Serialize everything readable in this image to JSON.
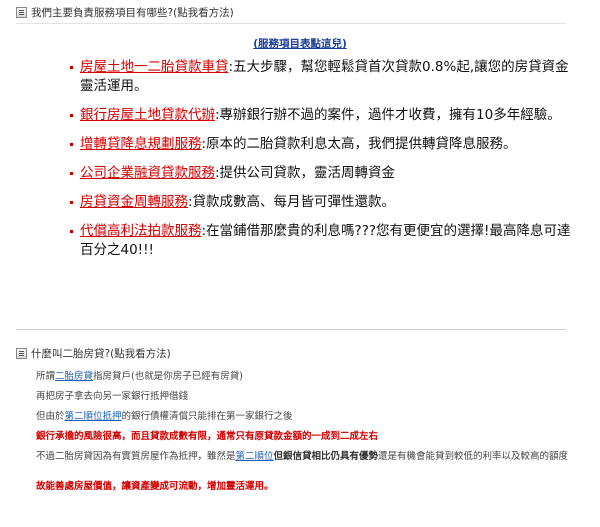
{
  "faq1": {
    "title": "我們主要負責服務項目有哪些?(點我看方法)",
    "service_link": "(服務項目表點這兒)"
  },
  "services": [
    {
      "link": "房屋土地一二胎貸款車貸",
      "desc": ":五大步驟，幫您輕鬆貸首次貸款0.8%起,讓您的房貸資金靈活運用。"
    },
    {
      "link": "銀行房屋土地貸款代辦",
      "desc": ":專辦銀行辦不過的案件，過件才收費，擁有10多年經驗。"
    },
    {
      "link": "增轉貸降息規劃服務",
      "desc": ":原本的二胎貸款利息太高，我們提供轉貸降息服務。"
    },
    {
      "link": "公司企業融資貸款服務",
      "desc": ":提供公司貸款，靈活周轉資金"
    },
    {
      "link": "房貸資金周轉服務",
      "desc": ":貸款成數高、每月皆可彈性還款。"
    },
    {
      "link": "代償高利法拍款服務",
      "desc": ":在當鋪借那麼貴的利息嗎???您有更便宜的選擇!最高降息可達百分之40!!!"
    }
  ],
  "faq2": {
    "title": "什麼叫二胎房貸?(點我看方法)",
    "line1_pre": "所謂",
    "line1_link": "二胎房貸",
    "line1_post": "指房貸戶(也就是你房子已經有房貸)",
    "line2": "再把房子拿去向另一家銀行抵押借錢",
    "line3_pre": "但由於",
    "line3_link": "第二順位抵押",
    "line3_post": "的銀行債權清償只能排在第一家銀行之後",
    "line4": "銀行承擔的風險很高，而且貸款成數有限，通常只有原貸款金額的一成到二成左右",
    "line5_pre": "不過二胎房貸因為有實質房屋作為抵押，雖然是",
    "line5_link": "第二順位",
    "line5_bold": "但銀信貸相比仍具有優勢",
    "line5_post": "還是有機會能貸到較低的利率以及較高的額度",
    "line6": "故能善處房屋價值，讓資產變成可流動，增加靈活運用。"
  }
}
